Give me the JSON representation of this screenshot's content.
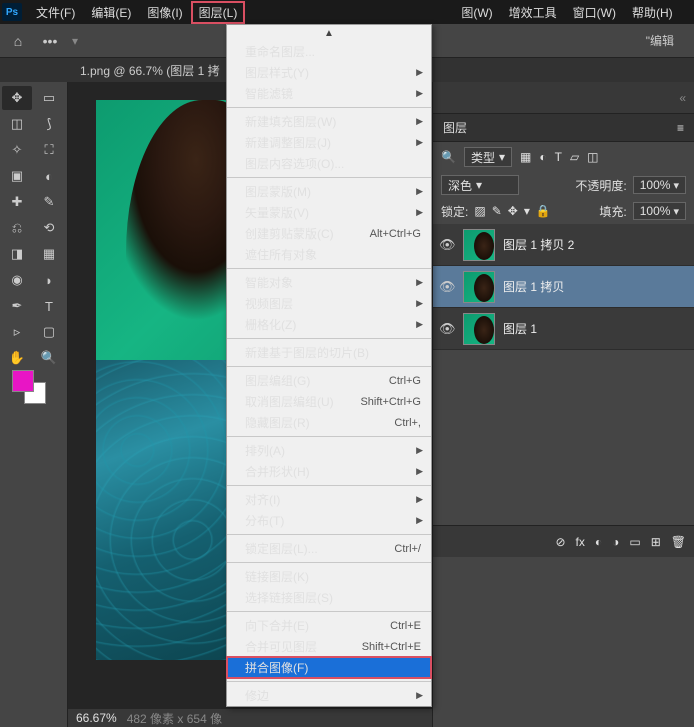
{
  "menubar": {
    "items": [
      "文件(F)",
      "编辑(E)",
      "图像(I)",
      "图层(L)",
      "图(W)",
      "增效工具",
      "窗口(W)",
      "帮助(H)"
    ],
    "highlighted_index": 3
  },
  "toolbar": {
    "edit_label": "\"编辑"
  },
  "doc_tab": "1.png @ 66.7% (图层 1 拷",
  "dropdown": {
    "top_arrow": "▲",
    "groups": [
      [
        {
          "label": "重命名图层...",
          "enabled": true
        },
        {
          "label": "图层样式(Y)",
          "enabled": true,
          "submenu": true
        },
        {
          "label": "智能滤镜",
          "enabled": false,
          "submenu": true
        }
      ],
      [
        {
          "label": "新建填充图层(W)",
          "enabled": true,
          "submenu": true
        },
        {
          "label": "新建调整图层(J)",
          "enabled": true,
          "submenu": true
        },
        {
          "label": "图层内容选项(O)...",
          "enabled": false
        }
      ],
      [
        {
          "label": "图层蒙版(M)",
          "enabled": true,
          "submenu": true
        },
        {
          "label": "矢量蒙版(V)",
          "enabled": true,
          "submenu": true
        },
        {
          "label": "创建剪贴蒙版(C)",
          "enabled": true,
          "shortcut": "Alt+Ctrl+G"
        },
        {
          "label": "遮住所有对象",
          "enabled": true
        }
      ],
      [
        {
          "label": "智能对象",
          "enabled": true,
          "submenu": true
        },
        {
          "label": "视频图层",
          "enabled": true,
          "submenu": true
        },
        {
          "label": "栅格化(Z)",
          "enabled": false,
          "submenu": true
        }
      ],
      [
        {
          "label": "新建基于图层的切片(B)",
          "enabled": true
        }
      ],
      [
        {
          "label": "图层编组(G)",
          "enabled": true,
          "shortcut": "Ctrl+G"
        },
        {
          "label": "取消图层编组(U)",
          "enabled": false,
          "shortcut": "Shift+Ctrl+G"
        },
        {
          "label": "隐藏图层(R)",
          "enabled": true,
          "shortcut": "Ctrl+,"
        }
      ],
      [
        {
          "label": "排列(A)",
          "enabled": true,
          "submenu": true
        },
        {
          "label": "合并形状(H)",
          "enabled": false,
          "submenu": true
        }
      ],
      [
        {
          "label": "对齐(I)",
          "enabled": true,
          "submenu": true
        },
        {
          "label": "分布(T)",
          "enabled": false,
          "submenu": true
        }
      ],
      [
        {
          "label": "锁定图层(L)...",
          "enabled": true,
          "shortcut": "Ctrl+/"
        }
      ],
      [
        {
          "label": "链接图层(K)",
          "enabled": false
        },
        {
          "label": "选择链接图层(S)",
          "enabled": false
        }
      ],
      [
        {
          "label": "向下合并(E)",
          "enabled": true,
          "shortcut": "Ctrl+E"
        },
        {
          "label": "合并可见图层",
          "enabled": true,
          "shortcut": "Shift+Ctrl+E"
        },
        {
          "label": "拼合图像(F)",
          "enabled": true,
          "highlight": true,
          "boxed": true
        }
      ],
      [
        {
          "label": "修边",
          "enabled": true,
          "submenu": true
        }
      ]
    ]
  },
  "layers_panel": {
    "tab": "图层",
    "filter_type": "类型",
    "blend_mode": "深色",
    "opacity_label": "不透明度:",
    "opacity_value": "100%",
    "lock_label": "锁定:",
    "fill_label": "填充:",
    "fill_value": "100%",
    "layers": [
      {
        "name": "图层 1 拷贝 2",
        "selected": false
      },
      {
        "name": "图层 1 拷贝",
        "selected": true
      },
      {
        "name": "图层 1",
        "selected": false
      }
    ]
  },
  "status": {
    "zoom": "66.67%",
    "dims": "482 像素 x 654 像"
  }
}
